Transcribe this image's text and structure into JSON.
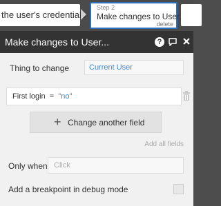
{
  "steps": {
    "step1_text": "the user's credentials",
    "step2_label": "Step 2",
    "step2_text": "Make changes to User...",
    "step2_delete": "delete"
  },
  "panel": {
    "title": "Make changes to User...",
    "help_icon": "?",
    "thing_label": "Thing to change",
    "thing_value": "Current User",
    "field_name": "First login  =  ",
    "field_value": "\"no\"",
    "change_button_label": "Change another field",
    "add_all_label": "Add all fields",
    "only_when_label": "Only when",
    "only_when_placeholder": "Click",
    "breakpoint_label": "Add a breakpoint in debug mode"
  },
  "icons": {
    "help": "help-icon",
    "chat": "comment-icon",
    "close": "close-icon",
    "trash": "trash-icon",
    "plus": "plus-icon"
  },
  "colors": {
    "accent": "#3a87d7",
    "step_border": "#2d6fb8",
    "header_bg": "#333333"
  }
}
